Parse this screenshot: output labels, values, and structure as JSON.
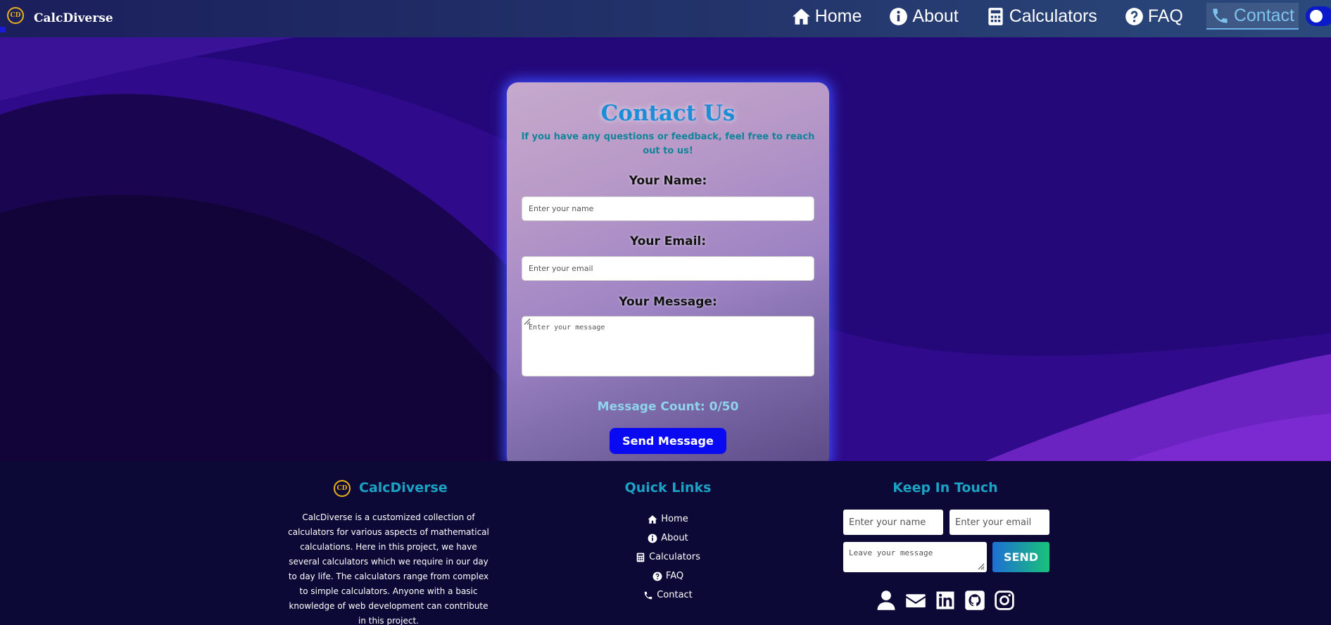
{
  "nav": {
    "brand_logo": "CD",
    "brand_name": "CalcDiverse",
    "items": [
      {
        "label": "Home",
        "icon": "home-icon"
      },
      {
        "label": "About",
        "icon": "info-icon"
      },
      {
        "label": "Calculators",
        "icon": "calculator-icon"
      },
      {
        "label": "FAQ",
        "icon": "question-icon"
      },
      {
        "label": "Contact",
        "icon": "phone-icon",
        "active": true
      }
    ],
    "theme_toggle": "theme-toggle"
  },
  "contact": {
    "title": "Contact Us",
    "subtitle": "If you have any questions or feedback, feel free to reach out to us!",
    "name_label": "Your Name:",
    "name_placeholder": "Enter your name",
    "email_label": "Your Email:",
    "email_placeholder": "Enter your email",
    "message_label": "Your Message:",
    "message_placeholder": "Enter your message",
    "message_count": "Message Count: 0/50",
    "send_label": "Send Message"
  },
  "footer": {
    "brand_logo": "CD",
    "brand_title": "CalcDiverse",
    "about_text": "CalcDiverse is a customized collection of calculators for various aspects of mathematical calculations. Here in this project, we have several calculators which we require in our day to day life. The calculators range from complex to simple calculators. Anyone with a basic knowledge of web development can contribute in this project.",
    "quick_links_title": "Quick Links",
    "quick_links": [
      {
        "label": "Home",
        "icon": "home-icon"
      },
      {
        "label": "About",
        "icon": "info-icon"
      },
      {
        "label": "Calculators",
        "icon": "calculator-icon"
      },
      {
        "label": "FAQ",
        "icon": "question-icon"
      },
      {
        "label": "Contact",
        "icon": "phone-icon"
      }
    ],
    "keep_in_touch_title": "Keep In Touch",
    "name_placeholder": "Enter your name",
    "email_placeholder": "Enter your email",
    "message_placeholder": "Leave your message",
    "send_label": "SEND",
    "social_icons": [
      "user-icon",
      "mail-icon",
      "linkedin-icon",
      "github-icon",
      "instagram-icon"
    ]
  },
  "colors": {
    "accent_blue": "#1c8ed8",
    "button_blue": "#0a0af2",
    "footer_title": "#1aa3c4",
    "logo_gold": "#e7b21a"
  }
}
